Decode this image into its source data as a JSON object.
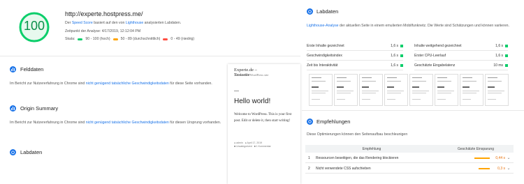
{
  "header": {
    "score": "100",
    "score_color": "#0cce6b",
    "url": "http://experte.hostpress.me/",
    "desc_prefix": "Der ",
    "desc_link1": "Speed Score",
    "desc_mid": " basiert auf den von ",
    "desc_link2": "Lighthouse",
    "desc_suffix": " analysierten Labdaten.",
    "time": "Zeitpunkt der Analyse: 4/17/2019, 12:12:04 PM",
    "scale_label": "Skala:",
    "scale": [
      {
        "label": "90 - 100 (hoch)",
        "color": "#0cce6b"
      },
      {
        "label": "50 - 89 (durchschnittlich)",
        "color": "#ffa400"
      },
      {
        "label": "0 - 49 (niedrig)",
        "color": "#ff4e42"
      }
    ]
  },
  "feld": {
    "title": "Felddaten",
    "text_prefix": "Im Bericht zur Nutzererfahrung in Chrome sind ",
    "text_link": "nicht genügend tatsächliche Geschwindigkeitsdaten",
    "text_suffix": " für diese Seite vorhanden."
  },
  "origin": {
    "title": "Origin Summary",
    "text_prefix": "Im Bericht zur Nutzererfahrung in Chrome sind ",
    "text_link": "nicht genügend tatsächliche Geschwindigkeitsdaten",
    "text_suffix": " für diesen Ursprung vorhanden."
  },
  "labdaten_left": {
    "title": "Labdaten"
  },
  "preview": {
    "site_title": "Experte.de – Testseite",
    "tagline": "Just another WordPress site",
    "post_title": "Hello world!",
    "body": "Welcome to WordPress. This is your first post. Edit or delete it, then start writing!",
    "meta_author": "admin",
    "meta_date": "April 17, 2019",
    "meta_cat": "Uncategorized",
    "meta_comment": "1 Kommentar"
  },
  "labdaten": {
    "title": "Labdaten",
    "desc_link": "Lighthouse-Analyse",
    "desc_text": " der aktuellen Seite in einem emulierten Mobilfunknetz. Die Werte sind Schätzungen und können variieren.",
    "metrics_left": [
      {
        "label": "Erste Inhalte gezeichnet",
        "value": "1,6 s"
      },
      {
        "label": "Geschwindigkeitsindex",
        "value": "1,6 s"
      },
      {
        "label": "Zeit bis Interaktivität",
        "value": "1,6 s"
      }
    ],
    "metrics_right": [
      {
        "label": "Inhalte weitgehend gezeichnet",
        "value": "1,6 s"
      },
      {
        "label": "Erster CPU-Leerlauf",
        "value": "1,6 s"
      },
      {
        "label": "Geschätzte Eingabelatenz",
        "value": "10 ms"
      }
    ]
  },
  "empfehlungen": {
    "title": "Empfehlungen",
    "desc": "Diese Optimierungen können den Seitenaufbau beschleunigen",
    "col_left": "Empfehlung",
    "col_right": "Geschätzte Einsparung",
    "rows": [
      {
        "num": "1",
        "label": "Ressourcen beseitigen, die das Rendering blockieren",
        "value": "0,44 s"
      },
      {
        "num": "2",
        "label": "Nicht verwendete CSS aufschieben",
        "value": "0,3 s"
      }
    ]
  }
}
